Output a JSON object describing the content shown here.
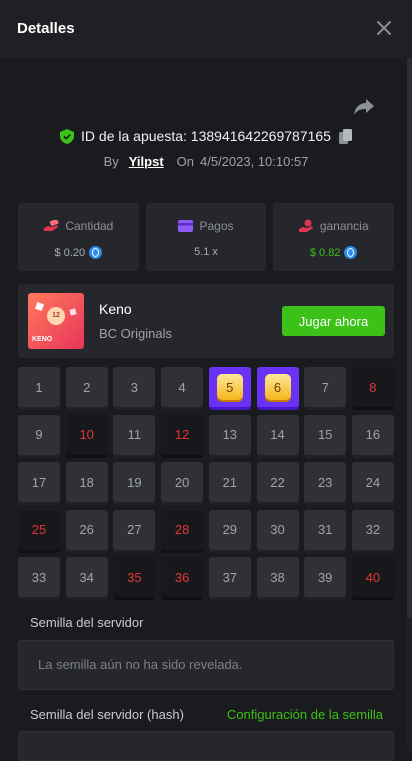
{
  "header": {
    "title": "Detalles",
    "close_icon": "close-icon"
  },
  "bet": {
    "id_label": "ID de la apuesta:",
    "id_value": "138941642269787165",
    "by_label": "By",
    "user": "Yilpst",
    "on_label": "On",
    "date": "4/5/2023, 10:10:57"
  },
  "stats": [
    {
      "label": "Cantidad",
      "value": "$ 0.20",
      "icon": "money-hand-icon",
      "coin": true,
      "color": "#a9acb2"
    },
    {
      "label": "Pagos",
      "value": "5.1 x",
      "icon": "wallet-card-icon",
      "coin": false,
      "color": "#a9acb2"
    },
    {
      "label": "ganancia",
      "value": "$ 0.82",
      "icon": "profit-hand-icon",
      "coin": true,
      "color": "#3bc117"
    }
  ],
  "game": {
    "name": "Keno",
    "provider": "BC Originals",
    "play_label": "Jugar ahora",
    "thumb_ball": "12",
    "thumb_text": "KENO"
  },
  "board": {
    "numbers": [
      1,
      2,
      3,
      4,
      5,
      6,
      7,
      8,
      9,
      10,
      11,
      12,
      13,
      14,
      15,
      16,
      17,
      18,
      19,
      20,
      21,
      22,
      23,
      24,
      25,
      26,
      27,
      28,
      29,
      30,
      31,
      32,
      33,
      34,
      35,
      36,
      37,
      38,
      39,
      40
    ],
    "selected_miss": [
      8,
      10,
      12,
      25,
      28,
      35,
      36,
      40
    ],
    "hits": [
      5,
      6
    ]
  },
  "seed": {
    "server_label": "Semilla del servidor",
    "server_placeholder": "La semilla aún no ha sido revelada.",
    "hash_label": "Semilla del servidor (hash)",
    "config_link": "Configuración de la semilla"
  },
  "colors": {
    "accent_green": "#3bc117",
    "hit_purple": "#6a32f5",
    "miss_red": "#e33536",
    "coin_blue": "#2b8cea"
  }
}
